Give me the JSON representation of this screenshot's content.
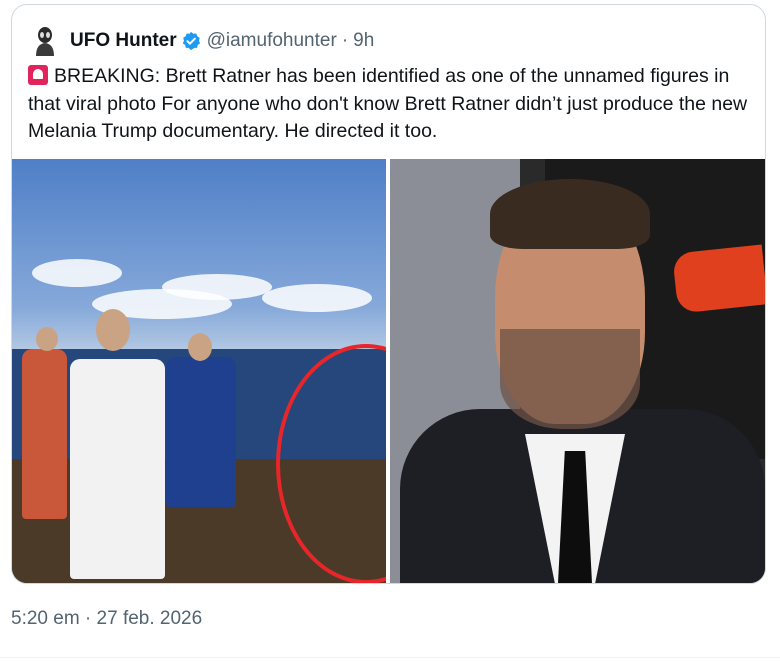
{
  "tweet": {
    "author": {
      "display_name": "UFO Hunter",
      "handle": "@iamufohunter",
      "verified": true,
      "avatar_icon": "alien-icon"
    },
    "separator": "·",
    "relative_time": "9h",
    "text": {
      "emoji_icon": "siren-icon",
      "body": "BREAKING:  Brett Ratner has been identified as one of the unnamed figures in that viral photo For anyone who don't know Brett Ratner didn’t just produce the new Melania Trump documentary. He directed it too."
    },
    "media": [
      {
        "icon": "group-photo-image"
      },
      {
        "icon": "portrait-photo-image"
      }
    ],
    "timestamp": "5:20 em · 27 feb. 2026"
  },
  "colors": {
    "text_primary": "#0f1419",
    "text_secondary": "#536471",
    "verified_blue": "#1d9bf0",
    "border": "#cfd9de",
    "highlight_red": "#e8262a"
  }
}
